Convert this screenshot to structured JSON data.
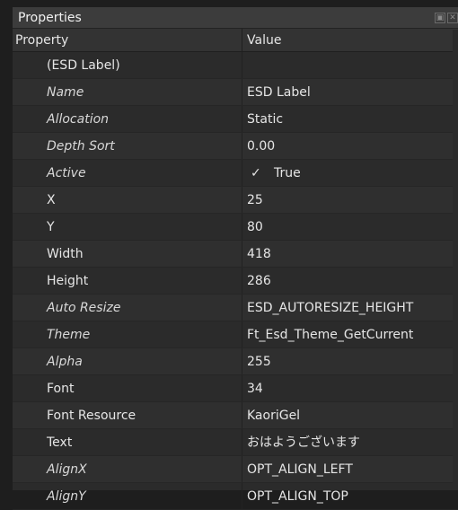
{
  "panel": {
    "title": "Properties",
    "header": {
      "property": "Property",
      "value": "Value"
    }
  },
  "rows": [
    {
      "name": "(ESD Label)",
      "value": "",
      "italic": false
    },
    {
      "name": "Name",
      "value": "ESD Label",
      "italic": true
    },
    {
      "name": "Allocation",
      "value": "Static",
      "italic": true
    },
    {
      "name": "Depth Sort",
      "value": "0.00",
      "italic": true
    },
    {
      "name": "Active",
      "value": "True",
      "italic": true,
      "check": "✓"
    },
    {
      "name": "X",
      "value": "25",
      "italic": false
    },
    {
      "name": "Y",
      "value": "80",
      "italic": false
    },
    {
      "name": "Width",
      "value": "418",
      "italic": false
    },
    {
      "name": "Height",
      "value": "286",
      "italic": false
    },
    {
      "name": "Auto Resize",
      "value": "ESD_AUTORESIZE_HEIGHT",
      "italic": true
    },
    {
      "name": "Theme",
      "value": "Ft_Esd_Theme_GetCurrent",
      "italic": true
    },
    {
      "name": "Alpha",
      "value": "255",
      "italic": true
    },
    {
      "name": "Font",
      "value": "34",
      "italic": false
    },
    {
      "name": "Font Resource",
      "value": "KaoriGel",
      "italic": false
    },
    {
      "name": "Text",
      "value": "おはようございます",
      "italic": false
    },
    {
      "name": "AlignX",
      "value": "OPT_ALIGN_LEFT",
      "italic": true
    },
    {
      "name": "AlignY",
      "value": "OPT_ALIGN_TOP",
      "italic": true
    }
  ]
}
